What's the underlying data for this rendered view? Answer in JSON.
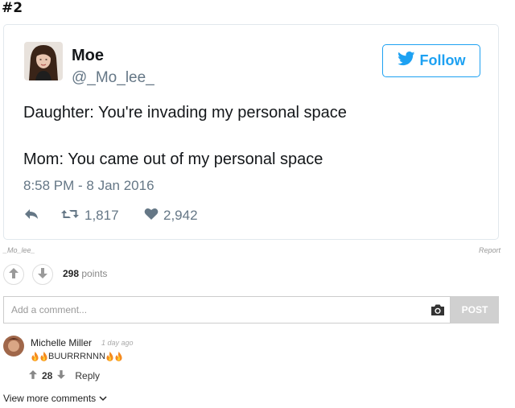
{
  "post": {
    "number": "#2"
  },
  "tweet": {
    "user_name": "Moe",
    "user_handle": "@_Mo_lee_",
    "follow_label": "Follow",
    "text_line_1": "Daughter: You're invading my personal space",
    "text_line_2": "Mom: You came out of my personal space",
    "timestamp": "8:58 PM - 8 Jan 2016",
    "retweets": "1,817",
    "likes": "2,942",
    "accent_color": "#1da1f2"
  },
  "meta": {
    "source_credit": "_Mo_lee_",
    "report_label": "Report"
  },
  "votes": {
    "points_value": "298",
    "points_label": "points"
  },
  "comment_form": {
    "placeholder": "Add a comment...",
    "post_label": "POST"
  },
  "comments": [
    {
      "author": "Michelle Miller",
      "time": "1 day ago",
      "text": "BUURRRNNN",
      "score": "28",
      "reply_label": "Reply"
    }
  ],
  "view_more_label": "View more comments",
  "icons": [
    "camera-icon",
    "reply-icon",
    "retweet-icon",
    "heart-icon",
    "twitter-bird-icon",
    "fire-icon",
    "arrow-up-icon",
    "arrow-down-icon",
    "chevron-down-icon"
  ]
}
